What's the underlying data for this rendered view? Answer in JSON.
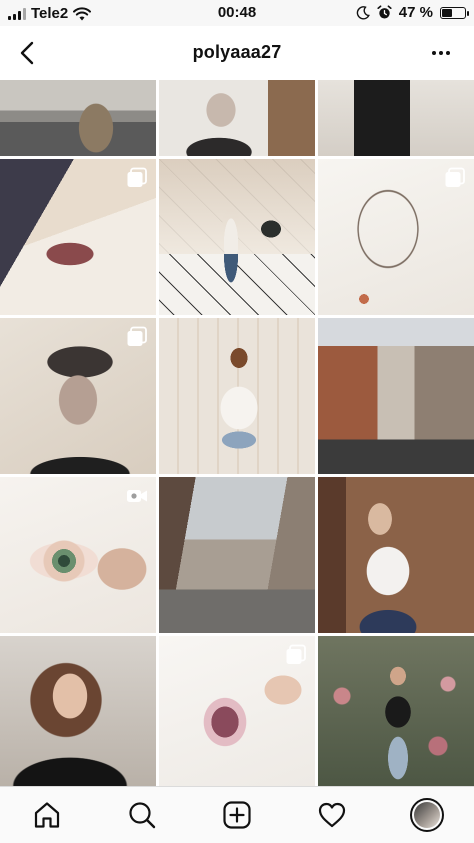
{
  "status_bar": {
    "carrier": "Tele2",
    "time": "00:48",
    "battery_percent_text": "47 %",
    "battery_level": 0.47,
    "icons": [
      "signal-icon",
      "wifi-icon",
      "moon-icon",
      "alarm-icon",
      "battery-icon"
    ]
  },
  "header": {
    "back_icon": "chevron-left-icon",
    "username": "polyaaa27",
    "more_icon": "more-dots-icon"
  },
  "grid": {
    "posts": [
      {
        "subject": "man on street photo",
        "badge": null
      },
      {
        "subject": "watercolor portrait in progress",
        "badge": null
      },
      {
        "subject": "woman torso black top",
        "badge": null
      },
      {
        "subject": "watercolor lips painting with palette",
        "badge": "multiple-photos-icon"
      },
      {
        "subject": "girl in white tiled room",
        "badge": null
      },
      {
        "subject": "ink sketch of man smoking",
        "badge": "multiple-photos-icon"
      },
      {
        "subject": "watercolor portrait of young man",
        "badge": "multiple-photos-icon"
      },
      {
        "subject": "girl sitting facing wall of sketches",
        "badge": null
      },
      {
        "subject": "city street with cafes",
        "badge": null
      },
      {
        "subject": "watercolor eye painting",
        "badge": "video-icon"
      },
      {
        "subject": "city street with cars",
        "badge": null
      },
      {
        "subject": "mirror selfie girl",
        "badge": null
      },
      {
        "subject": "girl portrait close-up",
        "badge": null
      },
      {
        "subject": "watercolor flower painting",
        "badge": "multiple-photos-icon"
      },
      {
        "subject": "girl in park with roses",
        "badge": null
      }
    ]
  },
  "tabbar": {
    "tabs": [
      "home-icon",
      "search-icon",
      "new-post-icon",
      "heart-icon",
      "profile-avatar"
    ]
  },
  "colors": {
    "status_bg": "#f7f7f7",
    "tabbar_bg": "#fafafa",
    "text": "#111111"
  }
}
